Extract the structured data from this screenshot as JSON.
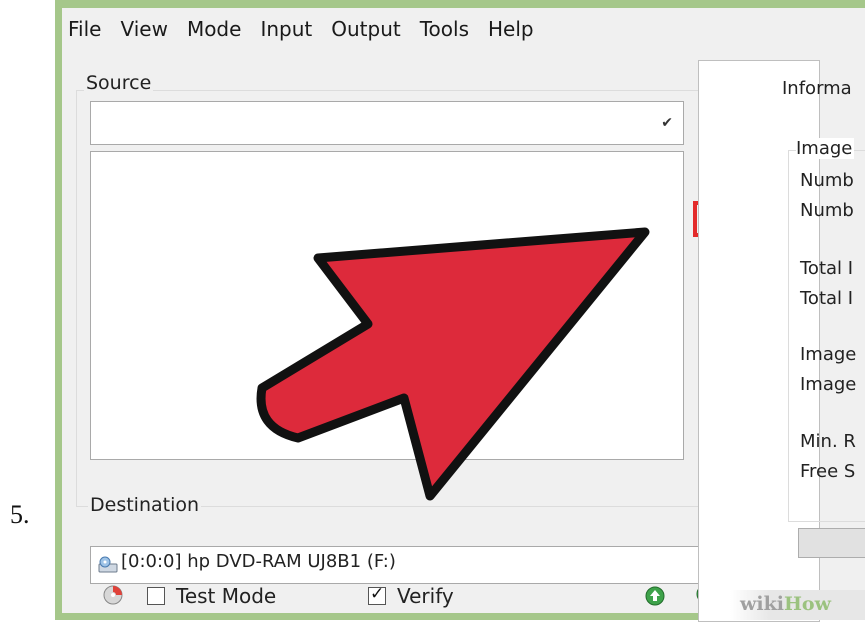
{
  "step": {
    "number": "5."
  },
  "menu": {
    "items": [
      "File",
      "View",
      "Mode",
      "Input",
      "Output",
      "Tools",
      "Help"
    ]
  },
  "source": {
    "label": "Source",
    "combo_value": "",
    "toolbar_icons": [
      "add-icon",
      "search-icon",
      "browse-folder-icon",
      "delete-icon",
      "clear-icon",
      "move-icon"
    ]
  },
  "destination": {
    "label": "Destination",
    "drive": "[0:0:0] hp DVD-RAM UJ8B1 (F:)"
  },
  "options": {
    "test_mode_label": "Test Mode",
    "test_mode_checked": false,
    "verify_label": "Verify",
    "verify_checked": true
  },
  "info": {
    "title": "Informa",
    "group_label": "Image",
    "lines": [
      "Numb",
      "Numb",
      "Total I",
      "Total I",
      "Image",
      "Image",
      "Min. R",
      "Free S"
    ]
  },
  "watermark": {
    "wiki": "wiki",
    "how": "How"
  },
  "colors": {
    "highlight": "#e32b2b",
    "arrow": "#dd2a3b",
    "frame": "#a5c78a"
  }
}
